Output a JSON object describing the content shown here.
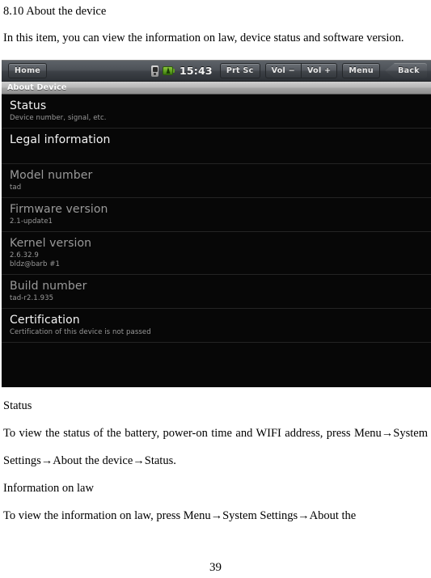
{
  "document": {
    "section_heading": "8.10 About the device",
    "intro_paragraph": "In this item, you can view the information on law, device status and software version.",
    "status_heading": "Status",
    "status_paragraph": "To view the status of the battery, power-on time and WIFI address, press Menu→System Settings→About the device→Status.",
    "law_heading": "Information on law",
    "law_paragraph": "To view the information on law, press Menu→System Settings→About the",
    "page_number": "39"
  },
  "device_screenshot": {
    "emulator_toolbar": {
      "home_label": "Home",
      "print_screen_label": "Prt Sc",
      "volume_down_label": "Vol −",
      "volume_up_label": "Vol +",
      "menu_label": "Menu",
      "back_label": "Back",
      "clock": "15:43",
      "icons": [
        "signal-icon",
        "battery-charging-icon"
      ]
    },
    "title_bar": {
      "title": "About Device"
    },
    "list_items": [
      {
        "title": "Status",
        "subtitle": "Device number, signal, etc.",
        "subtitle2": "",
        "state": "enabled"
      },
      {
        "title": "Legal information",
        "subtitle": "",
        "subtitle2": "",
        "state": "enabled"
      },
      {
        "title": "Model number",
        "subtitle": "tad",
        "subtitle2": "",
        "state": "disabled"
      },
      {
        "title": "Firmware version",
        "subtitle": "2.1-update1",
        "subtitle2": "",
        "state": "disabled"
      },
      {
        "title": "Kernel version",
        "subtitle": "2.6.32.9",
        "subtitle2": "bldz@barb #1",
        "state": "disabled"
      },
      {
        "title": "Build number",
        "subtitle": "tad-r2.1.935",
        "subtitle2": "",
        "state": "disabled"
      },
      {
        "title": "Certification",
        "subtitle": "Certification of this device is not passed",
        "subtitle2": "",
        "state": "enabled"
      }
    ],
    "colors": {
      "list_background": "#070707",
      "title_enabled": "#f4f4f4",
      "title_disabled": "#9a9a9a",
      "subtitle": "#9a9a9a",
      "battery_green": "#5fa021",
      "divider": "#242424"
    }
  }
}
